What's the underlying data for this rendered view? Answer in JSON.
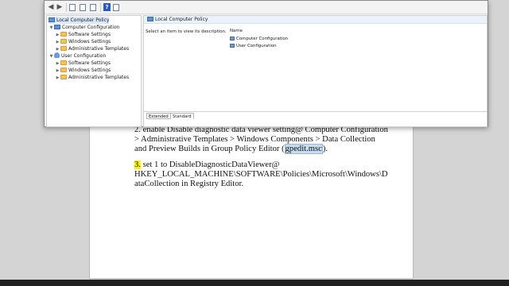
{
  "document": {
    "line1": "2. enable Disable diagnostic data viewer setting@ Computer Configuration",
    "line2": "> Administrative Templates > Windows Components > Data Collection",
    "line3_pre": "and Preview Builds in Group Policy Editor (",
    "line3_hl": "gpedit.msc",
    "line3_post": ").",
    "step3_num": "3.",
    "line4_rest": " set 1 to DisableDiagnosticDataViewer@",
    "line5": "HKEY_LOCAL_MACHINE\\SOFTWARE\\Policies\\Microsoft\\Windows\\D",
    "line6": "ataCollection in Registry Editor."
  },
  "gpedit": {
    "toolbar_icons": [
      "back-arrow-icon",
      "forward-arrow-icon",
      "up-folder-icon",
      "show-hide-tree-icon",
      "properties-icon",
      "help-icon",
      "view-icon"
    ],
    "tree": {
      "root": "Local Computer Policy",
      "computer_config": "Computer Configuration",
      "user_config": "User Configuration",
      "cc_children": [
        "Software Settings",
        "Windows Settings",
        "Administrative Templates"
      ],
      "uc_children": [
        "Software Settings",
        "Windows Settings",
        "Administrative Templates"
      ]
    },
    "right": {
      "header": "Local Computer Policy",
      "description": "Select an item to view its description.",
      "column_name": "Name",
      "items": [
        "Computer Configuration",
        "User Configuration"
      ]
    },
    "tabs": [
      "Extended",
      "Standard"
    ]
  },
  "colors": {
    "highlight_yellow": "#fff200",
    "highlight_blue": "#c8dcf0",
    "folder": "#f2c35c"
  }
}
